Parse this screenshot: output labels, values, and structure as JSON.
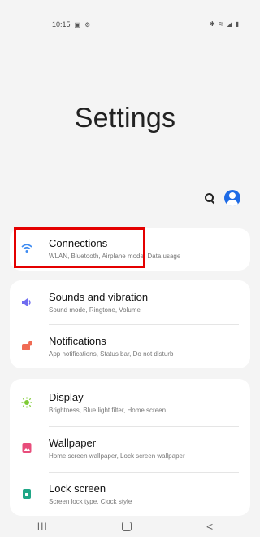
{
  "status_bar": {
    "time": "10:15"
  },
  "page": {
    "title": "Settings"
  },
  "groups": [
    [
      {
        "title": "Connections",
        "subtitle": "WLAN, Bluetooth, Airplane mode, Data usage",
        "icon": "wifi-icon",
        "color": "#3d8bf2"
      }
    ],
    [
      {
        "title": "Sounds and vibration",
        "subtitle": "Sound mode, Ringtone, Volume",
        "icon": "volume-icon",
        "color": "#6f6cf0"
      },
      {
        "title": "Notifications",
        "subtitle": "App notifications, Status bar, Do not disturb",
        "icon": "notification-icon",
        "color": "#f06b54"
      }
    ],
    [
      {
        "title": "Display",
        "subtitle": "Brightness, Blue light filter, Home screen",
        "icon": "brightness-icon",
        "color": "#7ecb34"
      },
      {
        "title": "Wallpaper",
        "subtitle": "Home screen wallpaper, Lock screen wallpaper",
        "icon": "wallpaper-icon",
        "color": "#e84d7b"
      },
      {
        "title": "Lock screen",
        "subtitle": "Screen lock type, Clock style",
        "icon": "lock-screen-icon",
        "color": "#1fa686"
      }
    ]
  ],
  "nav": {
    "recent": "III",
    "back": "<"
  }
}
